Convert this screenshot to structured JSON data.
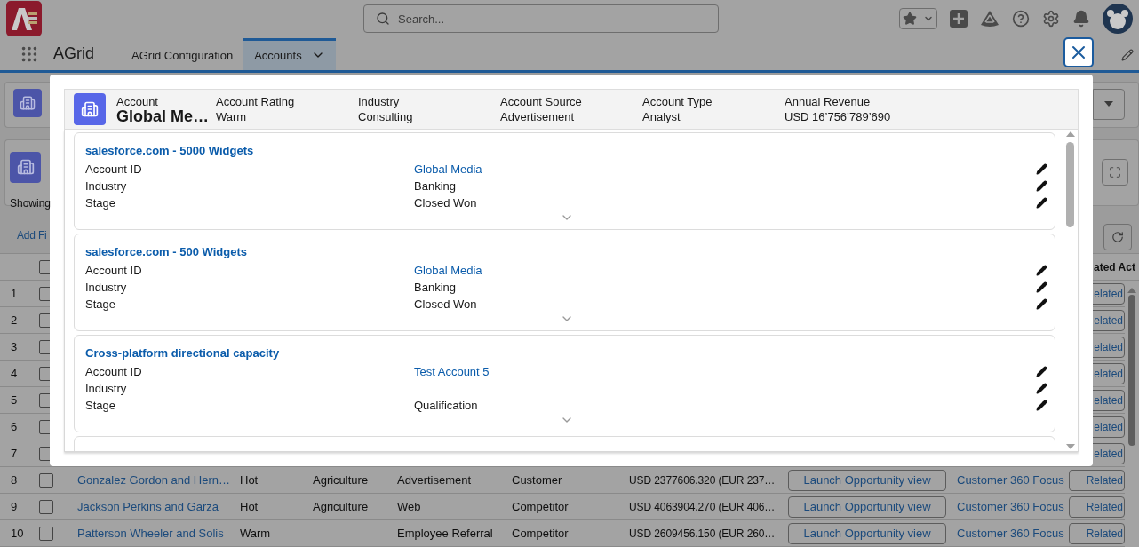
{
  "header": {
    "search_placeholder": "Search..."
  },
  "nav": {
    "app_name": "AGrid",
    "tabs": [
      {
        "label": "AGrid Configuration",
        "selected": false
      },
      {
        "label": "Accounts",
        "selected": true
      }
    ]
  },
  "page": {
    "showing_text": "Showing",
    "add_filter_text": "Add Fi"
  },
  "table": {
    "header_last": "ated Act",
    "header_checked": false,
    "rows": [
      {
        "number": "1",
        "checked": false,
        "related": "elated"
      },
      {
        "number": "2",
        "checked": false,
        "related": "elated"
      },
      {
        "number": "3",
        "checked": false,
        "related": "elated"
      },
      {
        "number": "4",
        "checked": false,
        "related": "elated"
      },
      {
        "number": "5",
        "checked": false,
        "related": "elated"
      },
      {
        "number": "6",
        "checked": false,
        "related": "elated"
      },
      {
        "number": "7",
        "checked": false,
        "related": "elated"
      },
      {
        "number": "8",
        "checked": false,
        "name": "Gonzalez Gordon and Hern…",
        "rating": "Hot",
        "industry": "Agriculture",
        "source": "Advertisement",
        "type": "Customer",
        "revenue": "USD 2377606.320 (EUR 237…",
        "launch": "Launch Opportunity view",
        "focus": "Customer 360 Focus",
        "related": "Related"
      },
      {
        "number": "9",
        "checked": false,
        "name": "Jackson Perkins and Garza",
        "rating": "Hot",
        "industry": "Agriculture",
        "source": "Web",
        "type": "Competitor",
        "revenue": "USD 4063904.270 (EUR 406…",
        "launch": "Launch Opportunity view",
        "focus": "Customer 360 Focus",
        "related": "Related"
      },
      {
        "number": "10",
        "checked": false,
        "name": "Patterson Wheeler and Solis",
        "rating": "Warm",
        "source": "Employee Referral",
        "type": "Competitor",
        "revenue": "USD 2609456.150 (EUR 260…",
        "launch": "Launch Opportunity view",
        "focus": "Customer 360 Focus",
        "related": "Related"
      }
    ]
  },
  "modal": {
    "header_fields": [
      {
        "label": "Account",
        "value": "Global Me…"
      },
      {
        "label": "Account Rating",
        "value": "Warm"
      },
      {
        "label": "Industry",
        "value": "Consulting"
      },
      {
        "label": "Account Source",
        "value": "Advertisement"
      },
      {
        "label": "Account Type",
        "value": "Analyst"
      },
      {
        "label": "Annual Revenue",
        "value": "USD 16’756’789’690"
      }
    ],
    "cards": [
      {
        "title": "salesforce.com - 5000 Widgets",
        "fields": [
          {
            "label": "Account ID",
            "value": "Global Media",
            "kind": "link"
          },
          {
            "label": "Industry",
            "value": "Banking",
            "kind": "text"
          },
          {
            "label": "Stage",
            "value": "Closed Won",
            "kind": "text"
          }
        ]
      },
      {
        "title": "salesforce.com - 500 Widgets",
        "fields": [
          {
            "label": "Account ID",
            "value": "Global Media",
            "kind": "link"
          },
          {
            "label": "Industry",
            "value": "Banking",
            "kind": "text"
          },
          {
            "label": "Stage",
            "value": "Closed Won",
            "kind": "text"
          }
        ]
      },
      {
        "title": "Cross-platform directional capacity",
        "fields": [
          {
            "label": "Account ID",
            "value": "Test Account 5",
            "kind": "link"
          },
          {
            "label": "Industry"
          },
          {
            "label": "Stage",
            "value": "Qualification",
            "kind": "text"
          }
        ]
      }
    ]
  }
}
